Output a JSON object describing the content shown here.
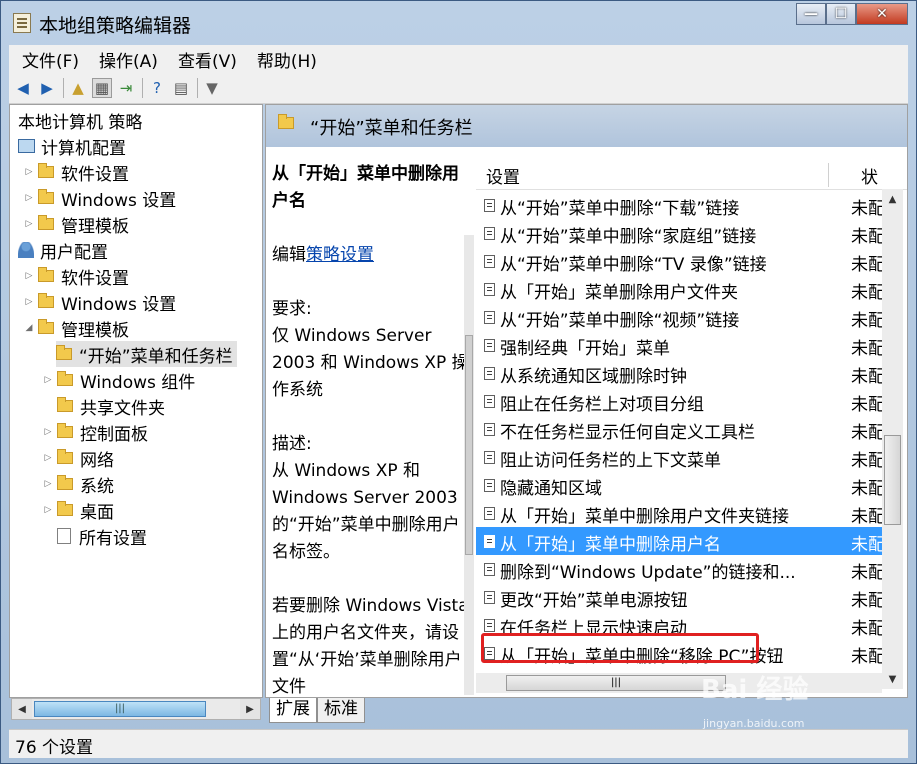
{
  "window": {
    "title": "本地组策略编辑器",
    "minimize": "—",
    "maximize": "☐",
    "close": "✕"
  },
  "menu": [
    "文件(F)",
    "操作(A)",
    "查看(V)",
    "帮助(H)"
  ],
  "tree": {
    "root": "本地计算机 策略",
    "computer": "计算机配置",
    "comp_software": "软件设置",
    "comp_windows": "Windows 设置",
    "comp_admin": "管理模板",
    "user": "用户配置",
    "user_software": "软件设置",
    "user_windows": "Windows 设置",
    "user_admin": "管理模板",
    "start_menu": "“开始”菜单和任务栏",
    "win_components": "Windows 组件",
    "shared_folders": "共享文件夹",
    "control_panel": "控制面板",
    "network": "网络",
    "system": "系统",
    "desktop": "桌面",
    "all_settings": "所有设置"
  },
  "header": {
    "title": "“开始”菜单和任务栏"
  },
  "description": {
    "title": "从「开始」菜单中删除用户名",
    "edit_prefix": "编辑",
    "edit_link": "策略设置",
    "req_label": "要求:",
    "req_text": "仅 Windows Server 2003 和 Windows XP 操作系统",
    "desc_label": "描述:",
    "desc_text": "从 Windows XP 和 Windows Server 2003 的“开始”菜单中删除用户名标签。",
    "extra_text": "若要删除 Windows Vista 上的用户名文件夹，请设置“从‘开始’菜单删除用户文件"
  },
  "list": {
    "col_setting": "设置",
    "col_state": "状",
    "rows": [
      {
        "name": "从“开始”菜单中删除“下载”链接",
        "state": "未配"
      },
      {
        "name": "从“开始”菜单中删除“家庭组”链接",
        "state": "未配"
      },
      {
        "name": "从“开始”菜单中删除“TV 录像”链接",
        "state": "未配"
      },
      {
        "name": "从「开始」菜单删除用户文件夹",
        "state": "未配"
      },
      {
        "name": "从“开始”菜单中删除“视频”链接",
        "state": "未配"
      },
      {
        "name": "强制经典「开始」菜单",
        "state": "未配"
      },
      {
        "name": "从系统通知区域删除时钟",
        "state": "未配"
      },
      {
        "name": "阻止在任务栏上对项目分组",
        "state": "未配"
      },
      {
        "name": "不在任务栏显示任何自定义工具栏",
        "state": "未配"
      },
      {
        "name": "阻止访问任务栏的上下文菜单",
        "state": "未配"
      },
      {
        "name": "隐藏通知区域",
        "state": "未配"
      },
      {
        "name": "从「开始」菜单中删除用户文件夹链接",
        "state": "未配"
      },
      {
        "name": "从「开始」菜单中删除用户名",
        "state": "未配"
      },
      {
        "name": "删除到“Windows Update”的链接和...",
        "state": "未配"
      },
      {
        "name": "更改“开始”菜单电源按钮",
        "state": "未配"
      },
      {
        "name": "在任务栏上显示快速启动",
        "state": "未配"
      },
      {
        "name": "从「开始」菜单中删除“移除 PC”按钮",
        "state": "未配"
      }
    ]
  },
  "tabs": [
    "扩展",
    "标准"
  ],
  "status": "76 个设置",
  "watermark": {
    "text": "Bai 经验",
    "url": "jingyan.baidu.com"
  }
}
